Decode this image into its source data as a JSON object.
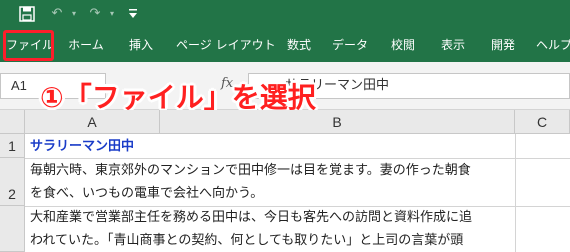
{
  "quick_access": {
    "save_icon": "💾",
    "undo_icon": "↶",
    "redo_icon": "↷",
    "dropdown_glyph": "▾",
    "customize_glyph": "⩡"
  },
  "ribbon": {
    "tabs": [
      {
        "label": "ファイル"
      },
      {
        "label": "ホーム"
      },
      {
        "label": "挿入"
      },
      {
        "label": "ページ レイアウト"
      },
      {
        "label": "数式"
      },
      {
        "label": "データ"
      },
      {
        "label": "校閲"
      },
      {
        "label": "表示"
      },
      {
        "label": "開発"
      },
      {
        "label": "ヘルプ"
      }
    ],
    "highlight_color": "#ff1e2b",
    "accent": "#227447"
  },
  "formula_bar": {
    "name_box": "A1",
    "fx": "fx",
    "content": "サラリーマン田中"
  },
  "annotation": {
    "text": "①「ファイル」を選択",
    "color": "#ff2020"
  },
  "sheet": {
    "columns": [
      "A",
      "B",
      "C"
    ],
    "rows": [
      "1",
      "2"
    ],
    "cells": {
      "a1": "サラリーマン田中",
      "a2_line1": "毎朝六時、東京郊外のマンションで田中修一は目を覚ます。妻の作った朝食",
      "a2_line2": "を食べ、いつもの電車で会社へ向かう。",
      "a3_line1": "大和産業で営業部主任を務める田中は、今日も客先への訪問と資料作成に追",
      "a3_line2": "われていた。「青山商事との契約、何としても取りたい」と上司の言葉が頭"
    }
  }
}
